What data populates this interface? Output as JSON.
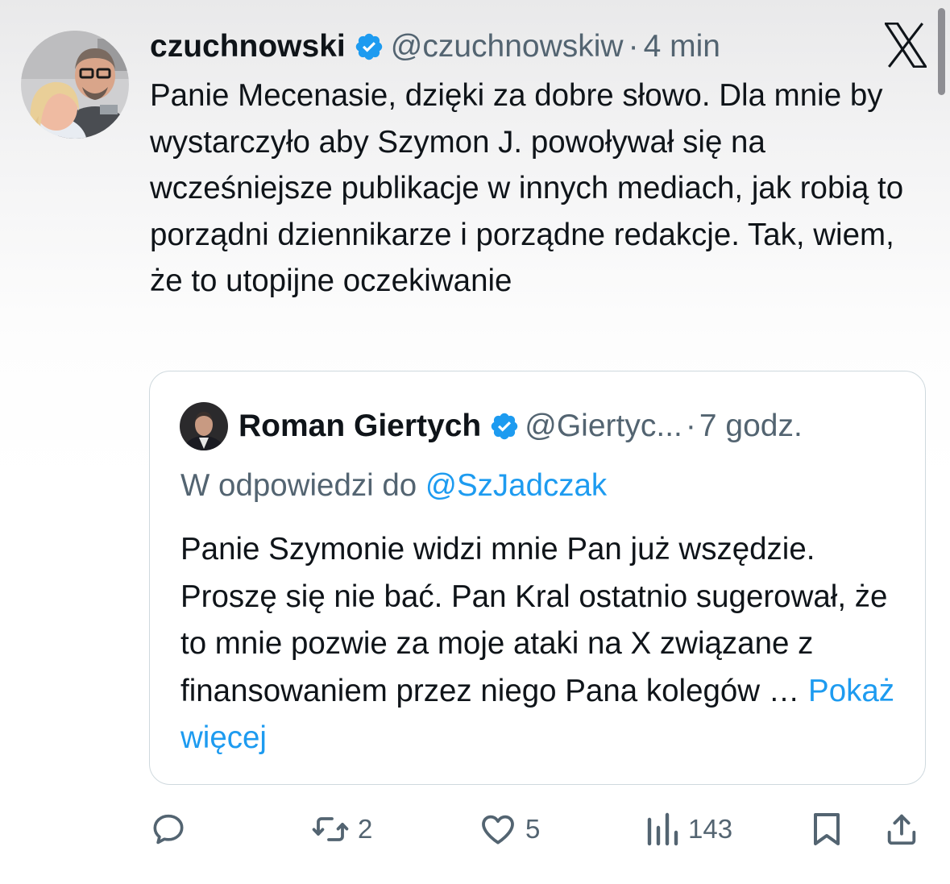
{
  "tweet": {
    "display_name": "czuchnowski",
    "handle": "@czuchnowskiw",
    "separator": "·",
    "time": "4 min",
    "text": "Panie Mecenasie, dzięki za dobre słowo. Dla mnie by wystarczyło aby Szymon J. powoływał się na wcześniejsze publikacje w innych mediach, jak robią to porządni dziennikarze i porządne redakcje. Tak, wiem, że to utopijne oczekiwanie"
  },
  "quote": {
    "display_name": "Roman Giertych",
    "handle": "@Giertyc...",
    "separator": "·",
    "time": "7 godz.",
    "reply_prefix": "W odpowiedzi do",
    "reply_handle": "@SzJadczak",
    "text": "Panie Szymonie widzi mnie Pan już wszędzie. Proszę się nie bać. Pan Kral ostatnio sugerował, że to mnie pozwie za moje ataki na X związane z finansowaniem przez niego Pana kolegów …",
    "show_more": "Pokaż więcej"
  },
  "actions": {
    "reply_icon": "reply-bubble-icon",
    "retweet_icon": "retweet-icon",
    "retweet_count": "2",
    "like_icon": "heart-icon",
    "like_count": "5",
    "views_icon": "bar-chart-icon",
    "views_count": "143",
    "bookmark_icon": "bookmark-icon",
    "share_icon": "share-upload-icon"
  },
  "colors": {
    "accent": "#1d9bf0",
    "muted_text": "#536471",
    "primary_text": "#0f1419",
    "border": "#cfd9de"
  }
}
